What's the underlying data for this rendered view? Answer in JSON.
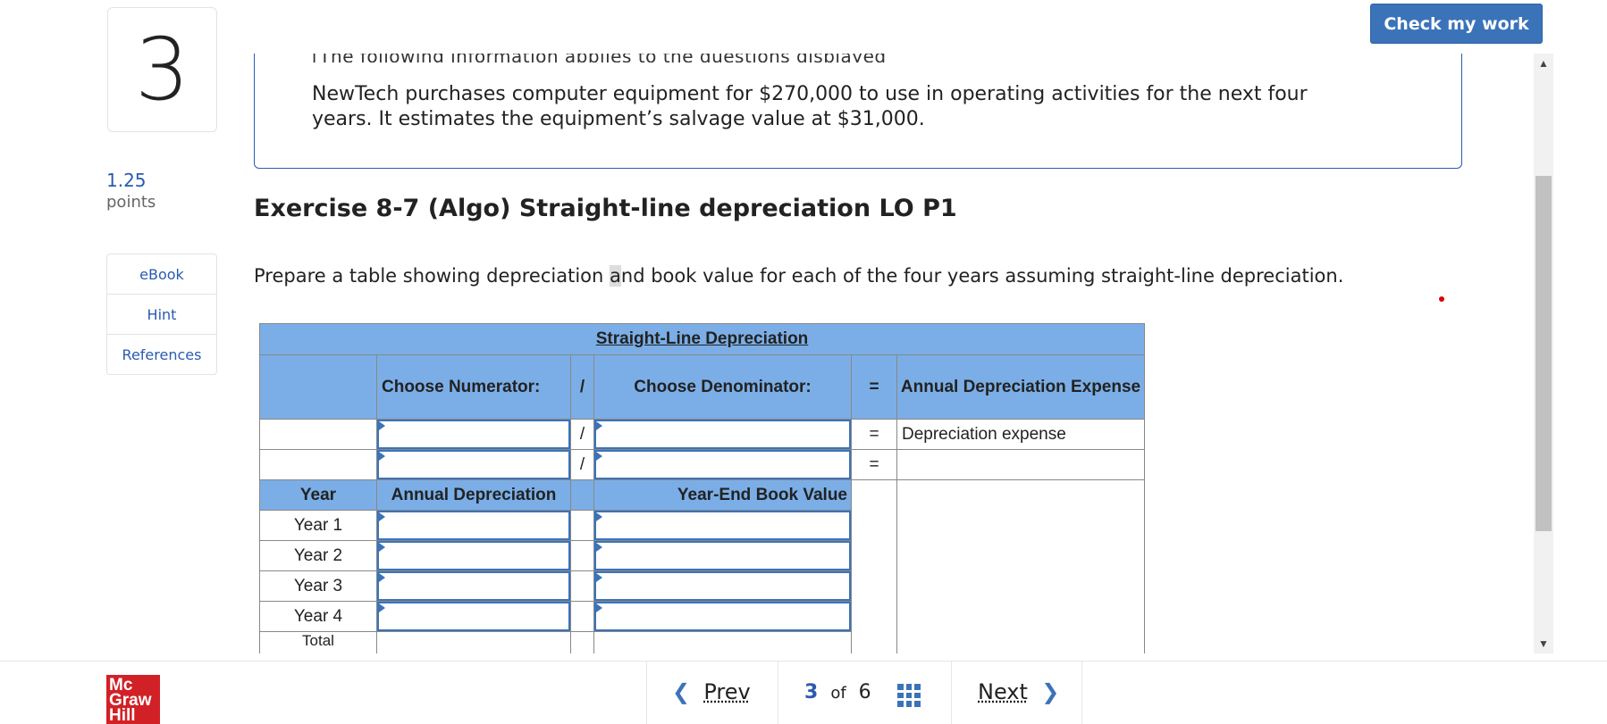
{
  "question": {
    "number": "3",
    "points_value": "1.25",
    "points_label": "points"
  },
  "sidebar": {
    "items": [
      {
        "label": "eBook"
      },
      {
        "label": "Hint"
      },
      {
        "label": "References"
      }
    ]
  },
  "toolbar": {
    "check_label": "Check my work"
  },
  "info": {
    "cut_text": "[The following information applies to the questions displayed below.]",
    "text": "NewTech purchases computer equipment for $270,000 to use in operating activities for the next four years. It estimates the equipment’s salvage value at $31,000."
  },
  "exercise": {
    "title": "Exercise 8-7 (Algo) Straight-line depreciation LO P1",
    "prompt_pre": "Prepare a table showing depreciation ",
    "prompt_hl": "a",
    "prompt_post": "nd book value for each of the four years assuming straight-line depreciation."
  },
  "table": {
    "title": "Straight-Line Depreciation",
    "col_numerator": "Choose Numerator:",
    "slash": "/",
    "col_denominator": "Choose Denominator:",
    "equals": "=",
    "col_result": "Annual Depreciation Expense",
    "row1_result": "Depreciation expense",
    "col_year": "Year",
    "col_annual": "Annual Depreciation",
    "col_book": "Year-End Book Value",
    "years": [
      "Year 1",
      "Year 2",
      "Year 3",
      "Year 4"
    ],
    "total_label": "Total"
  },
  "footer": {
    "brand": "Mc Graw Hill",
    "prev_label": "Prev",
    "current": "3",
    "of_label": "of",
    "total": "6",
    "next_label": "Next"
  }
}
